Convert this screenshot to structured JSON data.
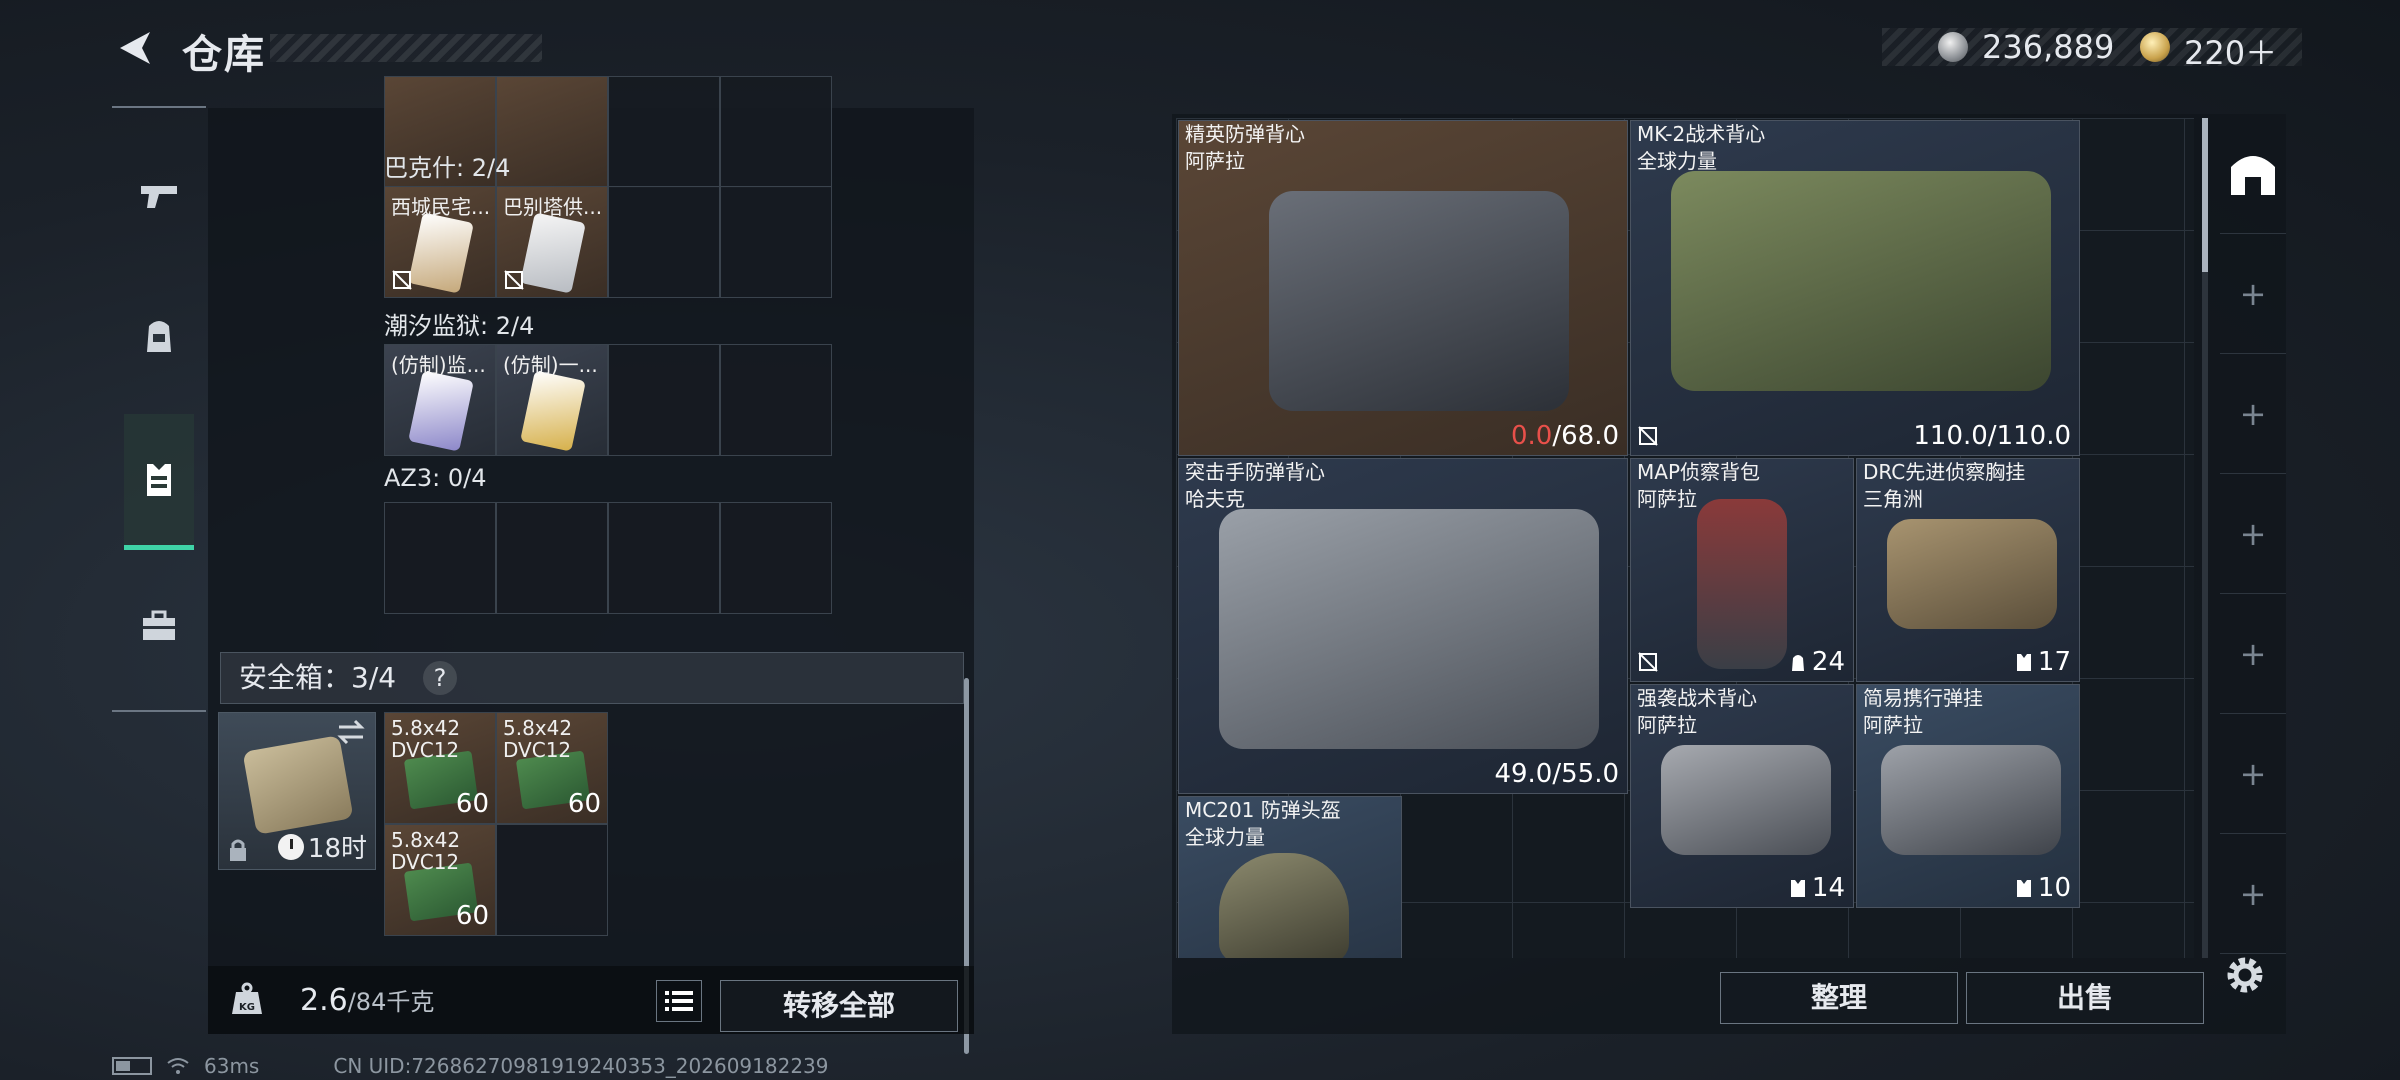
{
  "header": {
    "title": "仓库",
    "currency": [
      {
        "icon": "silver-coin-icon",
        "value": "236,889"
      },
      {
        "icon": "gold-coin-icon",
        "value": "220＋"
      }
    ]
  },
  "nav": {
    "items": [
      {
        "name": "weapons",
        "icon": "pistol-icon"
      },
      {
        "name": "backpack",
        "icon": "backpack-icon"
      },
      {
        "name": "vest",
        "icon": "vest-icon",
        "active": true
      },
      {
        "name": "toolbox",
        "icon": "toolbox-icon"
      }
    ]
  },
  "keycards": {
    "top_row": [
      "",
      "",
      "",
      ""
    ],
    "groups": [
      {
        "label": "巴克什: 2/4",
        "cells": [
          "西城民宅...",
          "巴别塔供..."
        ]
      },
      {
        "label": "潮汐监狱: 2/4",
        "cells": [
          "(仿制)监...",
          "(仿制)一..."
        ]
      },
      {
        "label": "AZ3: 0/4",
        "cells": []
      }
    ]
  },
  "safebox": {
    "label": "安全箱：3/4",
    "help": "?",
    "timer": "18时",
    "items": [
      {
        "name": "5.8x42",
        "sub": "DVC12",
        "qty": "60"
      },
      {
        "name": "5.8x42",
        "sub": "DVC12",
        "qty": "60"
      },
      {
        "name": "5.8x42",
        "sub": "DVC12",
        "qty": "60"
      }
    ]
  },
  "footer_left": {
    "weight_value": "2.6",
    "weight_max": "/84千克",
    "transfer_all": "转移全部"
  },
  "stash": {
    "items": [
      {
        "name": "精英防弹背心",
        "origin": "阿萨拉",
        "durability_current": "0.0",
        "durability_max": "/68.0"
      },
      {
        "name": "MK-2战术背心",
        "origin": "全球力量",
        "durability": "110.0/110.0"
      },
      {
        "name": "突击手防弹背心",
        "origin": "哈夫克",
        "durability": "49.0/55.0"
      },
      {
        "name": "MAP侦察背包",
        "origin": "阿萨拉",
        "capacity": "24"
      },
      {
        "name": "DRC先进侦察胸挂",
        "origin": "三角洲",
        "capacity": "17"
      },
      {
        "name": "强袭战术背心",
        "origin": "阿萨拉",
        "capacity": "14"
      },
      {
        "name": "简易携行弹挂",
        "origin": "阿萨拉",
        "capacity": "10"
      },
      {
        "name": "MC201 防弹头盔",
        "origin": "全球力量"
      }
    ]
  },
  "side_slots": [
    "+",
    "+",
    "+",
    "+",
    "+",
    "+"
  ],
  "actions": {
    "sort": "整理",
    "sell": "出售"
  },
  "status_bar": {
    "ping": "63ms",
    "uid": "CN UID:72686270981919240353_202609182239"
  },
  "colors": {
    "accent": "#3fd4a7",
    "durability_zero": "#e8504a",
    "item_brown": "#5a4636",
    "item_blue": "#2c3a4d"
  }
}
